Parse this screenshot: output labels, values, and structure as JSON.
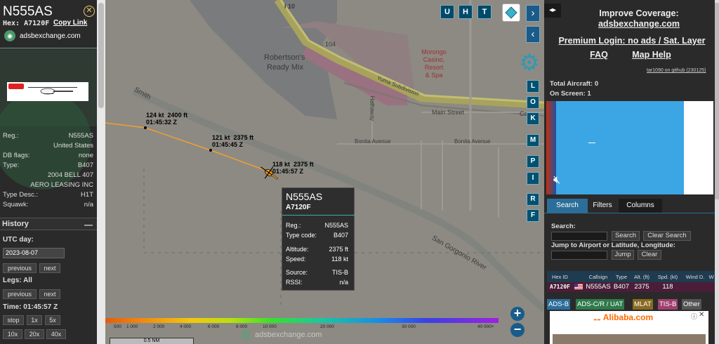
{
  "aircraft": {
    "callsign": "N555AS",
    "hex_label": "Hex:",
    "hex": "A7120F",
    "copy_link": "Copy Link",
    "site_link": "adsbexchange.com",
    "info": [
      {
        "k": "Reg.:",
        "v": "N555AS"
      },
      {
        "k": "",
        "v": "United States"
      },
      {
        "k": "DB flags:",
        "v": "none"
      },
      {
        "k": "Type:",
        "v": "B407"
      },
      {
        "k": "",
        "v": "2004 BELL 407"
      },
      {
        "k": "",
        "v": "AERO LEASING INC"
      },
      {
        "k": "Type Desc.:",
        "v": "H1T"
      },
      {
        "k": "Squawk:",
        "v": "n/a"
      }
    ]
  },
  "history": {
    "title": "History",
    "collapse": "—",
    "utc_day_label": "UTC day:",
    "date": "2023-08-07",
    "previous": "previous",
    "next": "next",
    "legs_label": "Legs: All",
    "time_label": "Time: 01:45:57 Z",
    "speed_buttons": [
      "stop",
      "1x",
      "5x",
      "10x",
      "20x",
      "40x"
    ]
  },
  "map": {
    "labels": {
      "robertsons": "Robertson's",
      "ready_mix": "Ready Mix",
      "morongo1": "Morongo",
      "morongo2": "Casino,",
      "morongo3": "Resort",
      "morongo4": "& Spa",
      "main_street": "Main Street",
      "bonita1": "Bonita Avenue",
      "bonita2": "Bonita Avenue",
      "yuma": "Yuma Subdivision",
      "smith": "Smith",
      "i10": "I 10",
      "r104": "104",
      "hathaway": "Hathaway",
      "san_gorgonio": "San Gorgonio River",
      "ca": "Ca"
    },
    "track_labels": [
      {
        "speed": "124 kt",
        "alt": "2400 ft",
        "time": "01:45:32 Z"
      },
      {
        "speed": "121 kt",
        "alt": "2375 ft",
        "time": "01:45:45 Z"
      },
      {
        "speed": "118 kt",
        "alt": "2375 ft",
        "time": "01:45:57 Z"
      }
    ],
    "buttons": {
      "u": "U",
      "h": "H",
      "t": "T"
    },
    "side_buttons": [
      "L",
      "O",
      "K",
      "M",
      "P",
      "I",
      "R",
      "F"
    ],
    "tooltip": {
      "callsign": "N555AS",
      "hex": "A7120F",
      "rows": [
        {
          "k": "Reg.:",
          "v": "N555AS"
        },
        {
          "k": "Type code:",
          "v": "B407"
        },
        {
          "k": "Altitude:",
          "v": "2375 ft"
        },
        {
          "k": "Speed:",
          "v": "118 kt"
        },
        {
          "k": "Source:",
          "v": "TIS-B"
        },
        {
          "k": "RSSI:",
          "v": "n/a"
        }
      ]
    },
    "altitude_scale": [
      "500",
      "1 000",
      "2 000",
      "4 000",
      "6 000",
      "8 000",
      "10 000",
      "20 000",
      "30 000",
      "40 000+"
    ],
    "scale_bar": "0.5 NM",
    "watermark": "adsbexchange.com",
    "zoom_in": "+",
    "zoom_out": "−"
  },
  "right": {
    "improve": "Improve Coverage:",
    "improve_link": "adsbexchange.com",
    "premium": "Premium Login: no ads / Sat. Layer",
    "faq": "FAQ",
    "maphelp": "Map Help",
    "version": "tar1090 on github (230125)",
    "total": "Total Aircraft: 0",
    "onscreen": "On Screen: 1",
    "tabs": [
      "Search",
      "Filters",
      "Columns"
    ],
    "search_label": "Search:",
    "search_btn": "Search",
    "clear_search_btn": "Clear Search",
    "jump_label": "Jump to Airport or Latitude, Longitude:",
    "jump_btn": "Jump",
    "clear_btn": "Clear",
    "columns": [
      "Hex ID",
      "",
      "Callsign",
      "Type",
      "Alt. (ft)",
      "Spd. (kt)",
      "Wind D.",
      "W"
    ],
    "row": {
      "hex": "A7120F",
      "callsign": "N555AS",
      "type": "B407",
      "alt": "2375",
      "spd": "118"
    },
    "sources": [
      "ADS-B",
      "ADS-C/R / UAT",
      "MLAT",
      "TIS-B",
      "Other"
    ],
    "ad_brand": "Alibaba.com"
  },
  "colors": {
    "track": "#f0a030",
    "accent": "#2c6e9a",
    "tisb": "#a04070",
    "row_bg": "#4a1e38"
  }
}
